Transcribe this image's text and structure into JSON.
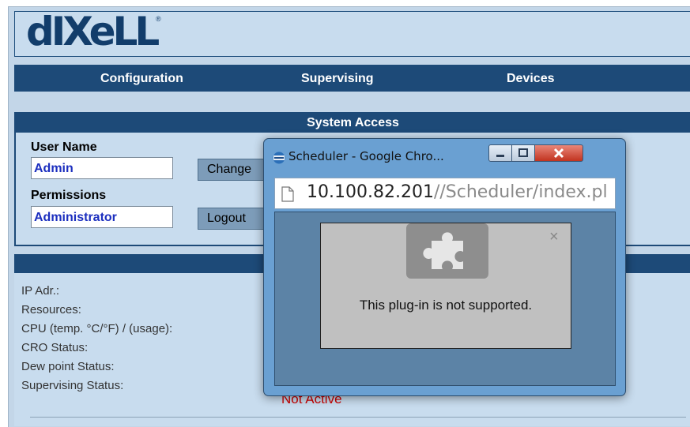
{
  "logo": {
    "text": "dIXeLL",
    "registered": "®"
  },
  "nav": {
    "items": [
      {
        "label": "Configuration"
      },
      {
        "label": "Supervising"
      },
      {
        "label": "Devices"
      }
    ]
  },
  "system_access": {
    "header": "System Access",
    "user_name_label": "User Name",
    "user_name_value": "Admin",
    "change_button": "Change",
    "permissions_label": "Permissions",
    "permissions_value": "Administrator",
    "logout_button": "Logout"
  },
  "status": {
    "rows": [
      {
        "label": "IP Adr.:"
      },
      {
        "label": "Resources:"
      },
      {
        "label": "CPU (temp. °C/°F) / (usage):"
      },
      {
        "label": "CRO Status:"
      },
      {
        "label": "Dew point Status:"
      },
      {
        "label": "Supervising Status:"
      }
    ],
    "supervising_value": "Not Active",
    "supervising_value_color": "#cc0000"
  },
  "popup": {
    "title": "Scheduler - Google Chro...",
    "url_host": "10.100.82.201",
    "url_path": "//Scheduler/index.pl",
    "plugin_message": "This plug-in is not supported.",
    "plugin_close": "×"
  },
  "colors": {
    "nav_background": "#1d4a78",
    "panel_background": "#c8dcee",
    "input_text": "#1c2fbf",
    "popup_frame": "#6aa0d2"
  },
  "icons": {
    "popup_app_icon": "chrome-icon",
    "page_icon": "page-icon",
    "plugin_icon": "puzzle-icon",
    "minimize": "minimize-icon",
    "maximize": "maximize-icon",
    "close": "close-icon"
  }
}
